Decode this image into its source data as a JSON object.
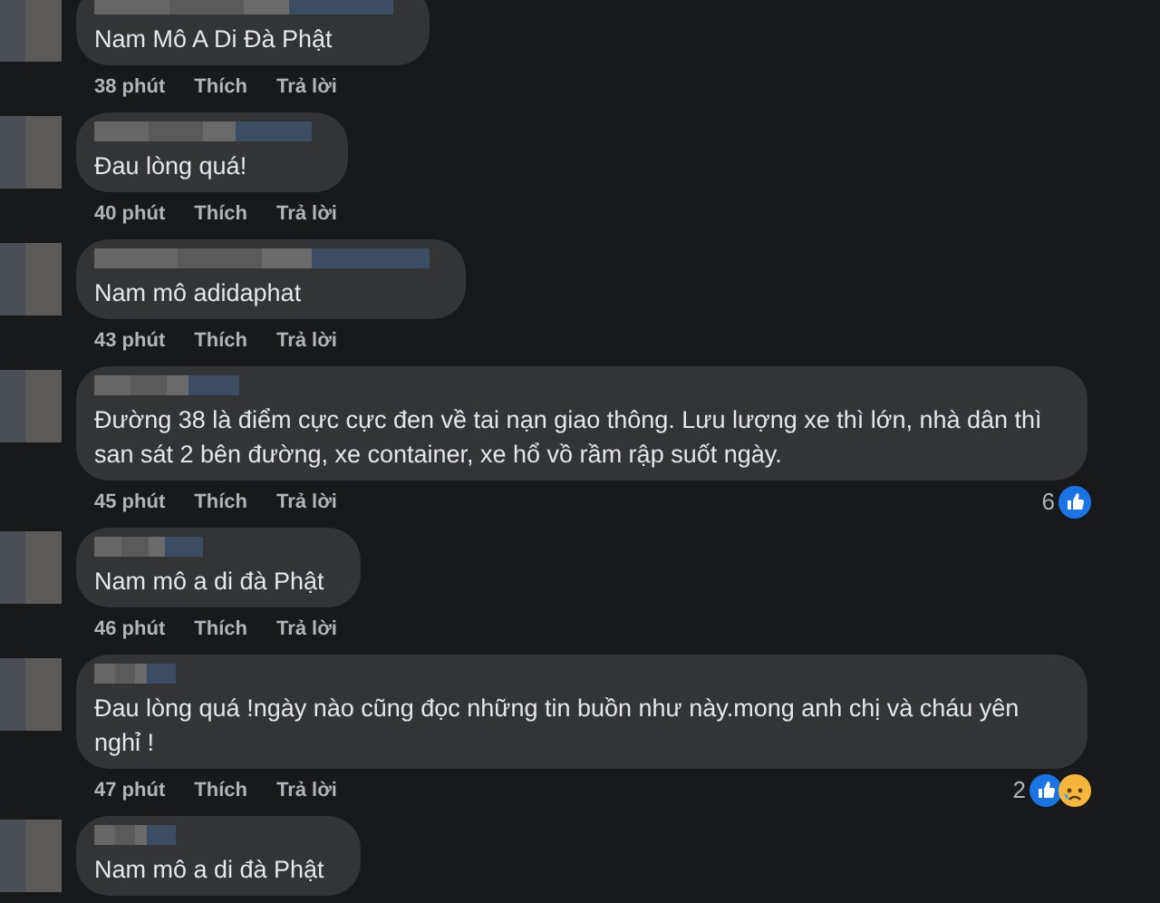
{
  "comments": [
    {
      "text": "Nam Mô A Di Đà Phật",
      "time": "38 phút",
      "like": "Thích",
      "reply": "Trả lời"
    },
    {
      "text": "Đau lòng quá!",
      "time": "40 phút",
      "like": "Thích",
      "reply": "Trả lời"
    },
    {
      "text": "Nam mô adidaphat",
      "time": "43 phút",
      "like": "Thích",
      "reply": "Trả lời"
    },
    {
      "text": "Đường 38 là điểm cực cực đen về tai nạn giao thông. Lưu lượng xe thì lớn, nhà dân thì san sát 2 bên đường, xe container, xe hổ vồ rầm rập suốt ngày.",
      "time": "45 phút",
      "like": "Thích",
      "reply": "Trả lời",
      "reactions": {
        "count": "6",
        "like": true,
        "sad": false
      }
    },
    {
      "text": "Nam mô a di đà Phật",
      "time": "46 phút",
      "like": "Thích",
      "reply": "Trả lời"
    },
    {
      "text": "Đau lòng quá !ngày nào cũng đọc những tin buồn như này.mong anh chị và cháu yên nghỉ !",
      "time": "47 phút",
      "like": "Thích",
      "reply": "Trả lời",
      "reactions": {
        "count": "2",
        "like": true,
        "sad": true
      }
    },
    {
      "text": "Nam mô a di đà Phật"
    }
  ]
}
